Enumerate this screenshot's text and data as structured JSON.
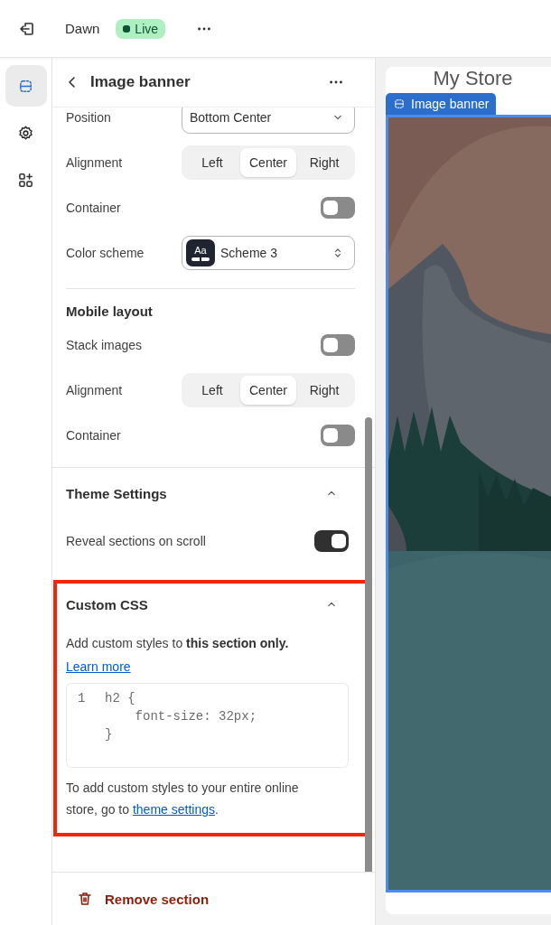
{
  "top_bar": {
    "theme_name": "Dawn",
    "status": "Live"
  },
  "rail": {
    "items": [
      {
        "kind": "sections",
        "selected": true
      },
      {
        "kind": "settings",
        "selected": false
      },
      {
        "kind": "apps",
        "selected": false
      }
    ]
  },
  "panel": {
    "title": "Image banner",
    "groups": [
      {
        "rows": [
          {
            "kind": "select",
            "label": "Position",
            "value": "Bottom Center"
          },
          {
            "kind": "segmented",
            "label": "Alignment",
            "options": [
              {
                "label": "Left",
                "selected": false
              },
              {
                "label": "Center",
                "selected": true
              },
              {
                "label": "Right",
                "selected": false
              }
            ]
          },
          {
            "kind": "toggle",
            "label": "Container",
            "on": false
          },
          {
            "kind": "scheme",
            "label": "Color scheme",
            "swatch": "Aa",
            "value": "Scheme 3"
          }
        ]
      },
      {
        "heading": "Mobile layout",
        "rows": [
          {
            "kind": "toggle",
            "label": "Stack images",
            "on": false
          },
          {
            "kind": "segmented",
            "label": "Alignment",
            "options": [
              {
                "label": "Left",
                "selected": false
              },
              {
                "label": "Center",
                "selected": true
              },
              {
                "label": "Right",
                "selected": false
              }
            ]
          },
          {
            "kind": "toggle",
            "label": "Container",
            "on": false
          }
        ]
      }
    ],
    "sections": [
      {
        "kind": "settings",
        "title": "Theme Settings",
        "expanded": true,
        "highlighted": false,
        "rows": [
          {
            "kind": "toggle",
            "label": "Reveal sections on scroll",
            "on": true
          }
        ]
      },
      {
        "kind": "css",
        "title": "Custom CSS",
        "expanded": true,
        "highlighted": true,
        "description": "Add custom styles to **this section only.**",
        "link": "Learn more",
        "code": [
          {
            "number": "1",
            "text": "h2 {"
          },
          {
            "text": "    font-size: 32px;"
          },
          {
            "text": "}"
          }
        ],
        "note": "To add custom styles to your entire online store, go to ",
        "note_link": "theme settings",
        "note_end": "."
      }
    ],
    "remove_button": "Remove section"
  },
  "preview": {
    "store_name": "My Store",
    "section_label": "Image banner"
  }
}
